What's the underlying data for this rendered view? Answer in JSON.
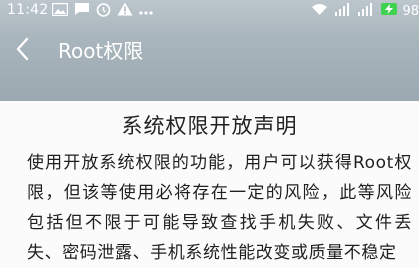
{
  "status_bar": {
    "time": "11:42",
    "battery_text": "98",
    "left_icons": [
      "image-icon",
      "message-icon",
      "alarm-clock-icon",
      "warning-icon",
      "dots-icon"
    ],
    "right_icons": [
      "wifi-icon",
      "signal-icon",
      "signal-icon",
      "charging-icon",
      "battery-icon"
    ]
  },
  "navbar": {
    "title": "Root权限"
  },
  "content": {
    "heading": "系统权限开放声明",
    "paragraph": "使用开放系统权限的功能，用户可以获得Root权限，但该等使用必将存在一定的风险，此等风险包括但不限于可能导致查找手机失败、文件丢失、密码泄露、手机系统性能改变或质量不稳定"
  },
  "colors": {
    "header_top": "#bcc6cd",
    "header_bottom": "#9aa8b0",
    "page_bg": "#fbfbfb",
    "text": "#1f1f1f"
  }
}
